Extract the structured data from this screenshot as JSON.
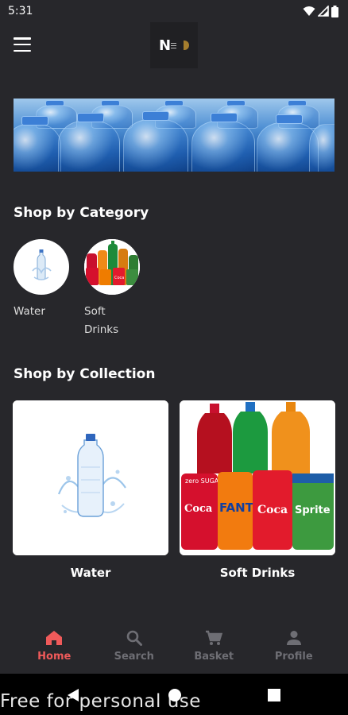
{
  "status_bar": {
    "time": "5:31",
    "icons": [
      "wifi-icon",
      "signal-icon",
      "battery-icon"
    ]
  },
  "app_bar": {
    "menu_icon": "hamburger-menu-icon",
    "logo_text": "N"
  },
  "banner": {
    "image": "water-bottles-banner"
  },
  "categories": {
    "title": "Shop by Category",
    "items": [
      {
        "label": "Water",
        "image": "water-bottle-image"
      },
      {
        "label": "Soft Drinks",
        "image": "soft-drinks-image"
      }
    ]
  },
  "collections": {
    "title": "Shop by Collection",
    "items": [
      {
        "label": "Water",
        "image": "water-splash-bottle-image"
      },
      {
        "label": "Soft Drinks",
        "image": "soda-bottles-cans-image"
      }
    ]
  },
  "bottom_nav": {
    "items": [
      {
        "label": "Home",
        "icon": "home-icon",
        "active": true
      },
      {
        "label": "Search",
        "icon": "search-icon",
        "active": false
      },
      {
        "label": "Basket",
        "icon": "cart-icon",
        "active": false
      },
      {
        "label": "Profile",
        "icon": "person-icon",
        "active": false
      }
    ]
  },
  "system_nav": {
    "icons": [
      "back-icon",
      "home-circle-icon",
      "recents-icon"
    ]
  },
  "watermark": "Free for personal use",
  "colors": {
    "background": "#27272b",
    "accent_active": "#ef5a5a",
    "inactive": "#6e6e74"
  }
}
